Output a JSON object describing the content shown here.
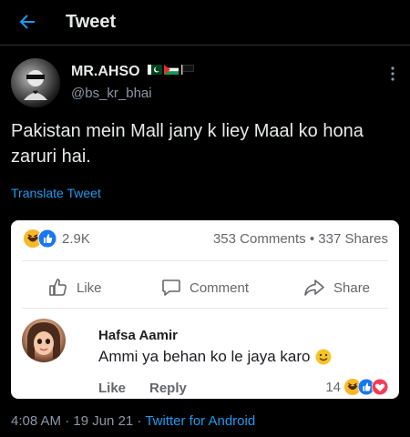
{
  "header": {
    "title": "Tweet",
    "back_icon": "arrow-left-icon"
  },
  "author": {
    "name": "MR.AHSO",
    "handle": "@bs_kr_bhai",
    "flags": [
      "pakistan-flag-icon",
      "palestine-flag-icon",
      "black-flag-icon"
    ]
  },
  "tweet": {
    "text": "Pakistan mein Mall  jany k liey Maal ko hona zaruri hai.",
    "translate_label": "Translate Tweet"
  },
  "fb_card": {
    "reaction_count": "2.9K",
    "stats": "353 Comments • 337 Shares",
    "actions": {
      "like": "Like",
      "comment": "Comment",
      "share": "Share"
    },
    "comment": {
      "author": "Hafsa Aamir",
      "text": "Ammi ya behan ko le jaya karo",
      "like": "Like",
      "reply": "Reply",
      "reaction_count": "14"
    }
  },
  "meta": {
    "time_date": "4:08 AM · 19 Jun 21 · ",
    "source": "Twitter for Android"
  },
  "colors": {
    "accent": "#1d9bf0",
    "background": "#000000",
    "card": "#ffffff",
    "fb_like": "#1877f2",
    "haha": "#f7b928",
    "love": "#f33e58"
  }
}
